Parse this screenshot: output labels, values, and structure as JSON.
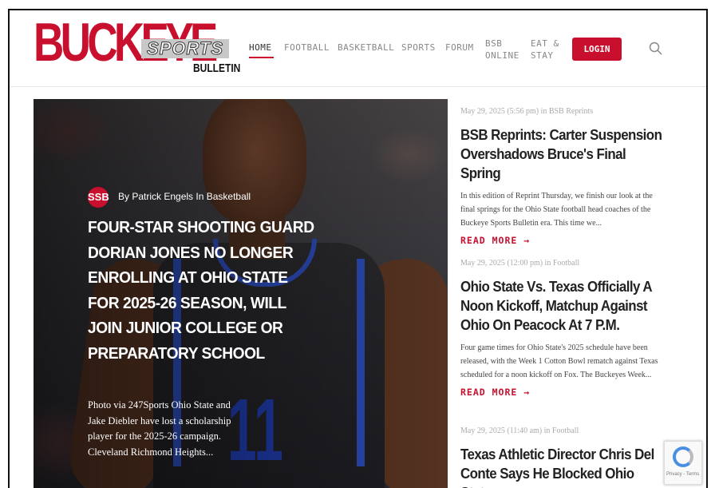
{
  "logo": {
    "main": "BUCKEYE",
    "sports": "SPORTS",
    "bulletin": "BULLETIN"
  },
  "nav": {
    "items": [
      "HOME",
      "FOOTBALL",
      "BASKETBALL",
      "SPORTS",
      "FORUM"
    ],
    "bsb_line1": "BSB",
    "bsb_line2": "ONLINE",
    "eat_line1": "EAT &",
    "eat_line2": "STAY",
    "active": "HOME",
    "login": "LOGIN",
    "search_icon": "search-icon"
  },
  "hero": {
    "badge": "SSB",
    "byline": "By Patrick Engels In Basketball",
    "title": "FOUR-STAR SHOOTING GUARD DORIAN JONES NO LONGER ENROLLING AT OHIO STATE FOR 2025-26 SEASON, WILL JOIN JUNIOR COLLEGE OR PREPARATORY SCHOOL",
    "excerpt": "Photo via 247Sports Ohio State and Jake Diebler have lost a scholarship player for the 2025-26 campaign. Cleveland Richmond Heights...",
    "jersey_number": "11"
  },
  "articles": [
    {
      "meta": "May 29, 2025 (5:56 pm) in BSB Reprints",
      "title": "BSB Reprints: Carter Suspension Overshadows Bruce's Final Spring",
      "excerpt": "In this edition of Reprint Thursday, we finish our look at the final springs for the Ohio State football head coaches of the Buckeye Sports Bulletin era. This time we...",
      "read_more": "READ MORE →"
    },
    {
      "meta": "May 29, 2025 (12:00 pm) in Football",
      "title": "Ohio State Vs. Texas Officially A Noon Kickoff, Matchup Against Ohio On Peacock At 7 P.M.",
      "excerpt": "Four game times for Ohio State's 2025 schedule have been released, with the Week 1 Cotton Bowl rematch against Texas scheduled for a noon kickoff on Fox. The Buckeyes Week...",
      "read_more": "READ MORE →"
    },
    {
      "meta": "May 29, 2025 (11:40 am) in Football",
      "title": "Texas Athletic Director Chris Del Conte Says He Blocked Ohio State",
      "excerpt": "",
      "read_more": ""
    }
  ],
  "recaptcha": {
    "text": "Privacy - Terms"
  },
  "colors": {
    "brand_red": "#c8102e",
    "jersey_blue": "#2c4bb8"
  }
}
